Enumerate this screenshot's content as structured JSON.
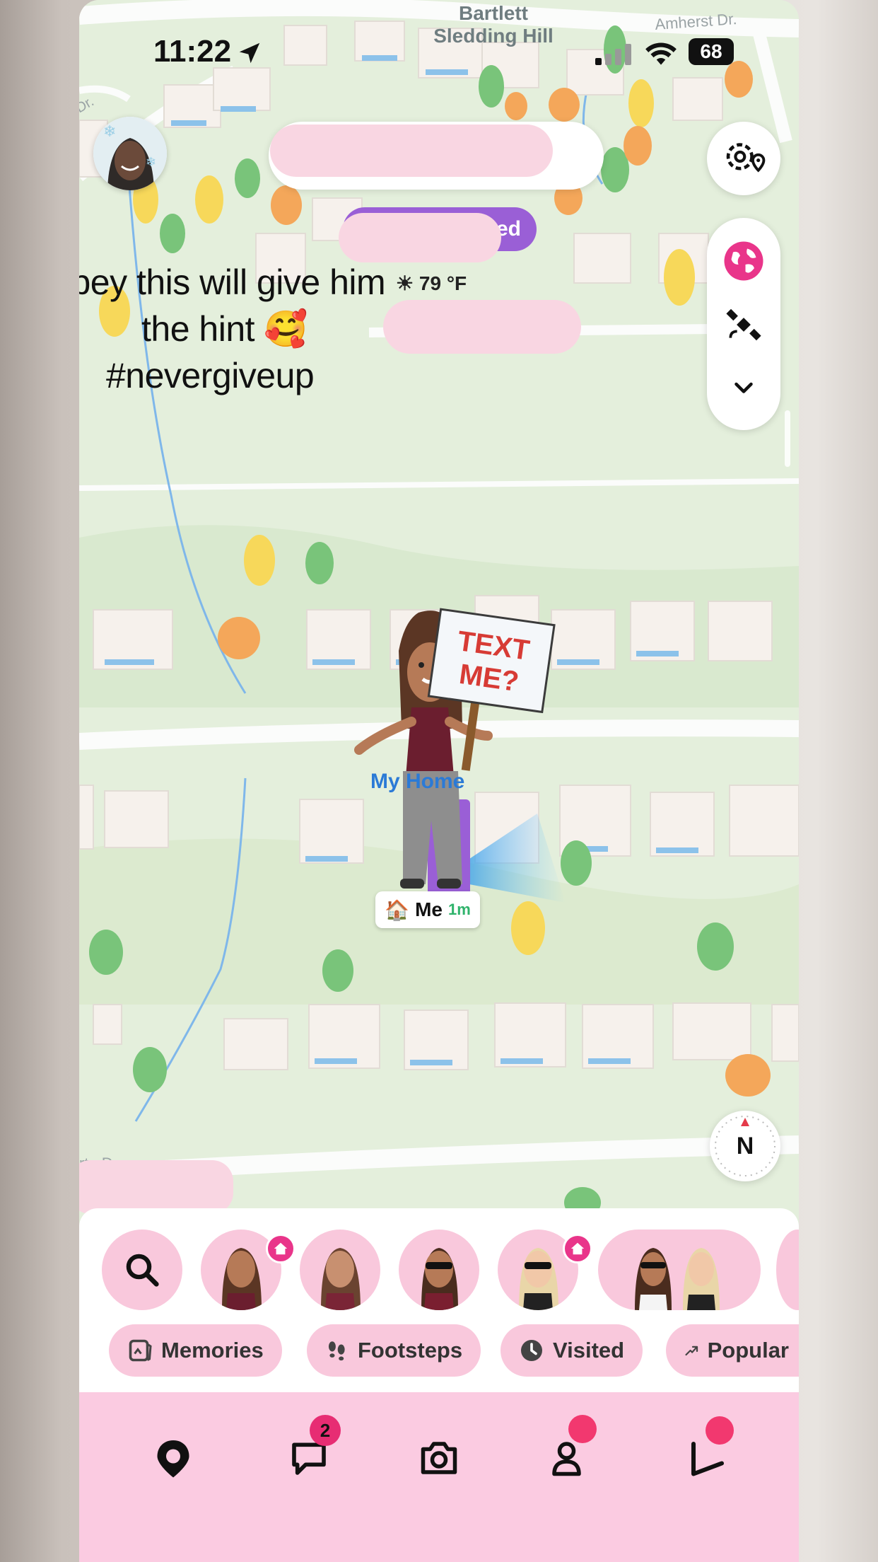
{
  "status_bar": {
    "time": "11:22",
    "battery": "68"
  },
  "map": {
    "labels": {
      "place": "Bartlett\nSledding Hill",
      "street_top_right": "Amherst Dr.",
      "street_left": "Dr.",
      "street_bottom_left": "rtn Dr."
    },
    "weather": "79 °F",
    "purple_pill_text": "ed",
    "my_home_label": "My Home",
    "me_label": "Me",
    "me_time": "1m",
    "sign_text": "TEXT\nME?",
    "compass": "N"
  },
  "caption": {
    "line1": "mabey this will give him",
    "line2": "the hint 🥰",
    "line3": "#nevergiveup"
  },
  "chips": [
    {
      "label": "Memories",
      "icon": "memories-icon"
    },
    {
      "label": "Footsteps",
      "icon": "footsteps-icon"
    },
    {
      "label": "Visited",
      "icon": "clock-icon"
    },
    {
      "label": "Popular",
      "icon": "trending-arrow-icon"
    }
  ],
  "nav": {
    "chat_badge": "2"
  },
  "colors": {
    "accent_pink": "#f9c8dc",
    "nav_bg": "#fbcbe1",
    "badge": "#e72d73",
    "map_green": "#e4efdc",
    "purple": "#9a5fd6"
  }
}
